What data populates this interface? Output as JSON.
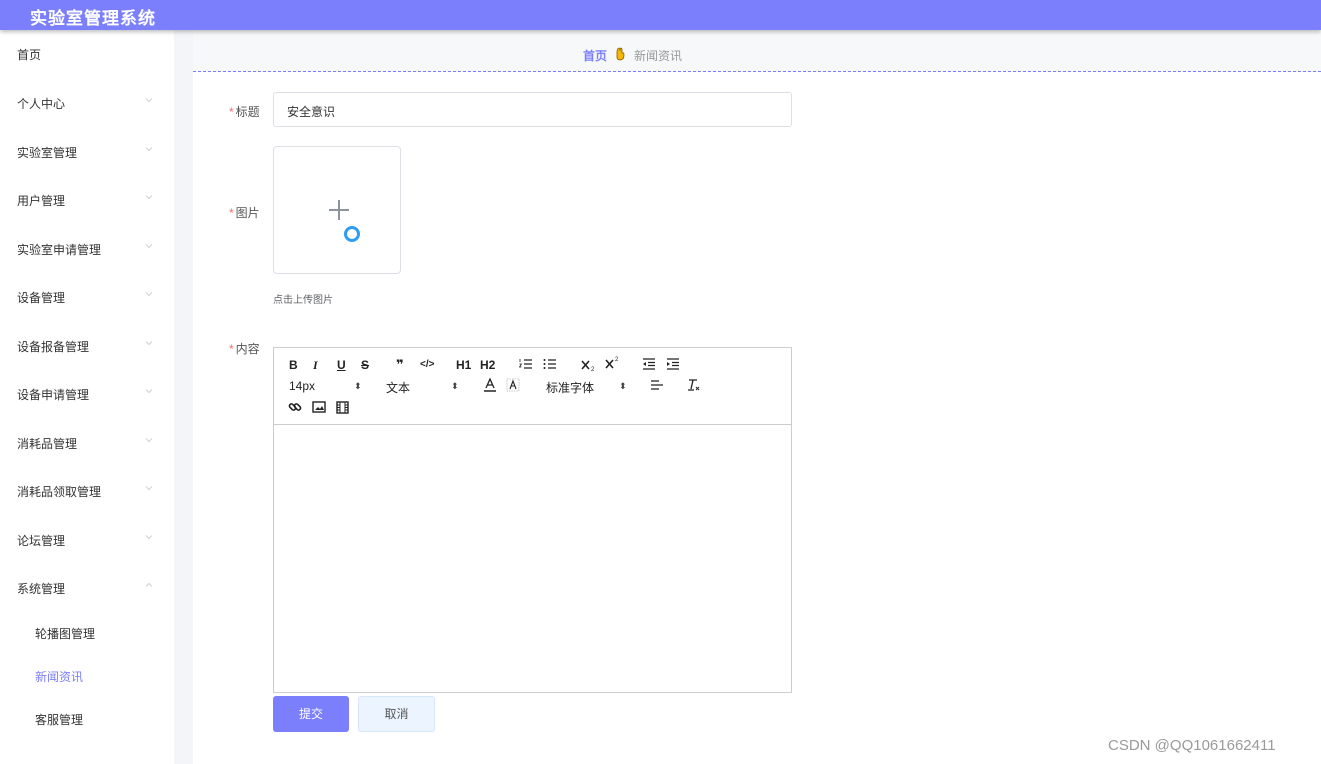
{
  "app": {
    "title": "实验室管理系统"
  },
  "sidebar": {
    "items": [
      {
        "label": "首页",
        "has_arrow": false
      },
      {
        "label": "个人中心",
        "has_arrow": true
      },
      {
        "label": "实验室管理",
        "has_arrow": true
      },
      {
        "label": "用户管理",
        "has_arrow": true
      },
      {
        "label": "实验室申请管理",
        "has_arrow": true
      },
      {
        "label": "设备管理",
        "has_arrow": true
      },
      {
        "label": "设备报备管理",
        "has_arrow": true
      },
      {
        "label": "设备申请管理",
        "has_arrow": true
      },
      {
        "label": "消耗品管理",
        "has_arrow": true
      },
      {
        "label": "消耗品领取管理",
        "has_arrow": true
      },
      {
        "label": "论坛管理",
        "has_arrow": true
      },
      {
        "label": "系统管理",
        "has_arrow": true,
        "expanded": true
      }
    ],
    "subitems": [
      {
        "label": "轮播图管理",
        "active": false
      },
      {
        "label": "新闻资讯",
        "active": true
      },
      {
        "label": "客服管理",
        "active": false
      }
    ]
  },
  "breadcrumb": {
    "home": "首页",
    "current": "新闻资讯"
  },
  "form": {
    "title_label": "标题",
    "title_value": "安全意识",
    "image_label": "图片",
    "upload_tip": "点击上传图片",
    "content_label": "内容",
    "required_mark": "*"
  },
  "editor": {
    "toolbar": {
      "bold": "B",
      "italic": "I",
      "underline": "U",
      "strike": "S",
      "quote": "❞",
      "code": "</>",
      "h1": "H1",
      "h2": "H2",
      "font_size": "14px",
      "text_type": "文本",
      "font_family": "标准字体",
      "select_arrow": "⬍"
    }
  },
  "buttons": {
    "submit": "提交",
    "cancel": "取消"
  },
  "watermark": "CSDN @QQ1061662411",
  "colors": {
    "accent": "#7b7ffc",
    "required": "#f56c6c",
    "upload_ring": "#2f9cf3"
  }
}
